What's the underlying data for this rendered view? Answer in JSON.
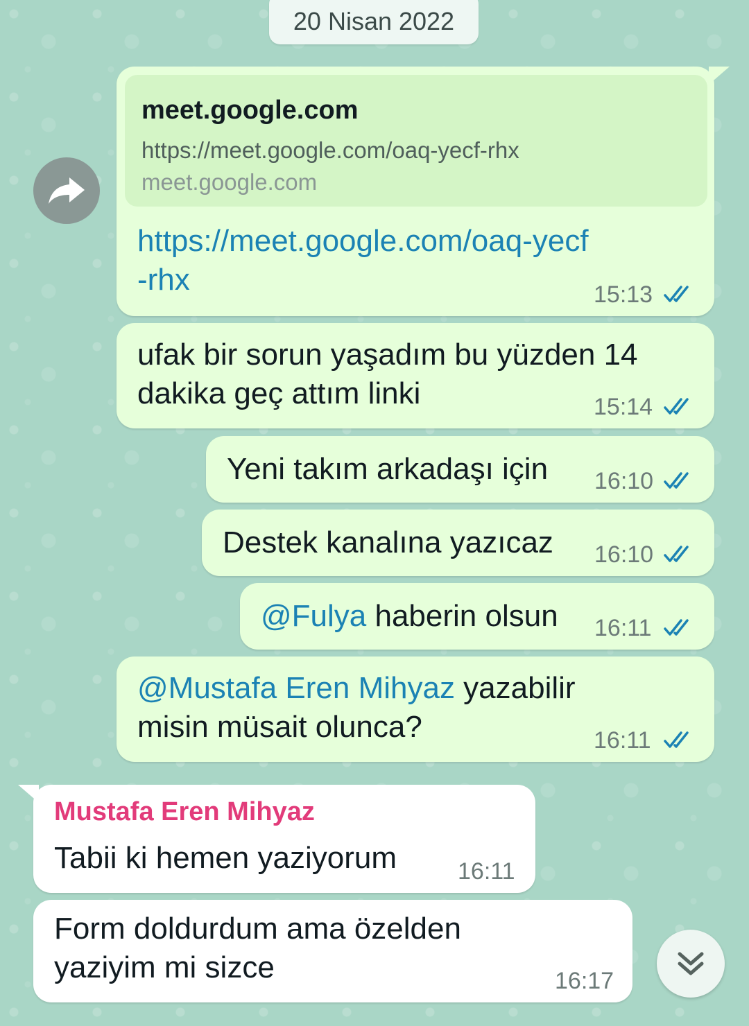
{
  "date_chip": "20 Nisan 2022",
  "messages": [
    {
      "preview_title": "meet.google.com",
      "preview_url": "https://meet.google.com/oaq-yecf-rhx",
      "preview_domain": "meet.google.com",
      "link_line1": "https://meet.google.com/oaq-yecf",
      "link_line2": "-rhx",
      "time": "15:13"
    },
    {
      "line1": "ufak bir sorun yaşadım bu yüzden 14",
      "line2": "dakika geç attım linki",
      "time": "15:14"
    },
    {
      "text": "Yeni takım arkadaşı için",
      "time": "16:10"
    },
    {
      "text": "Destek kanalına yazıcaz",
      "time": "16:10"
    },
    {
      "mention": "@Fulya",
      "text": " haberin olsun",
      "time": "16:11"
    },
    {
      "mention": "@Mustafa Eren Mihyaz",
      "text": " yazabilir",
      "line2": "misin müsait olunca?",
      "time": "16:11"
    },
    {
      "sender": "Mustafa Eren Mihyaz",
      "text": "Tabii ki hemen yaziyorum",
      "time": "16:11"
    },
    {
      "line1": "Form doldurdum ama özelden",
      "line2": "yaziyim mi sizce",
      "time": "16:17"
    }
  ],
  "icons": {
    "forward": "forward-arrow-icon",
    "read_receipt": "double-check-icon",
    "scroll_down": "double-chevron-down-icon"
  },
  "colors": {
    "outgoing_bubble": "#e6ffda",
    "incoming_bubble": "#ffffff",
    "link": "#1b82b4",
    "read_ticks": "#1b82b4",
    "sender_name": "#e23b7a",
    "wallpaper": "#a9d6c6"
  }
}
